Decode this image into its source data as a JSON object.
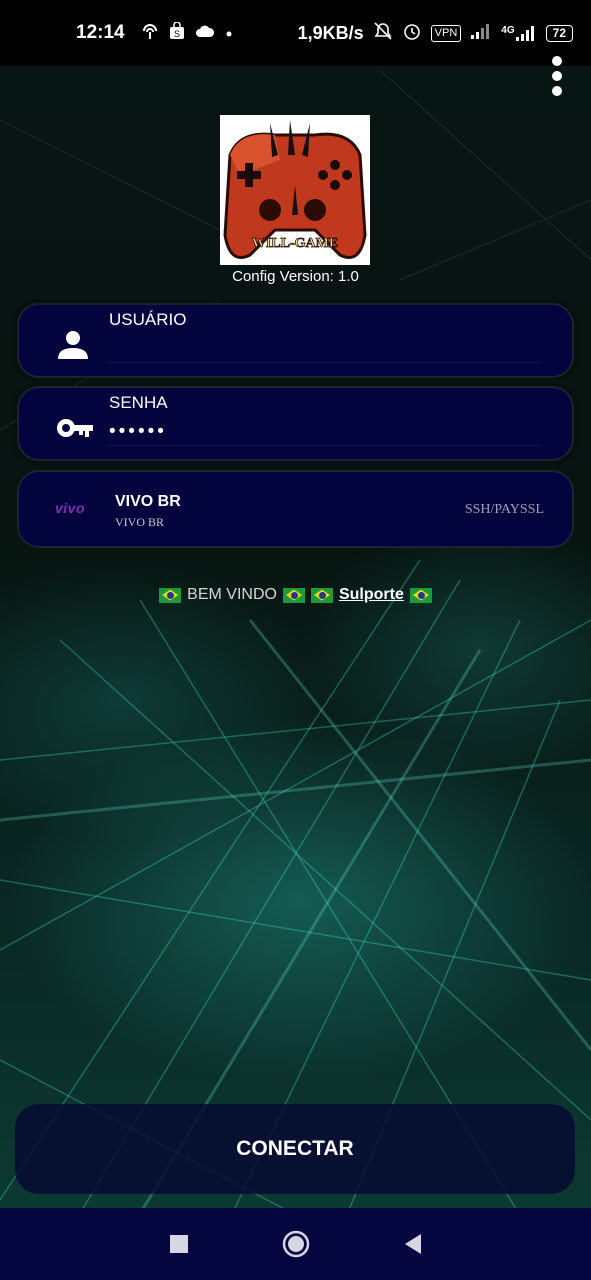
{
  "status_bar": {
    "time": "12:14",
    "net_speed": "1,9KB/s",
    "vpn": "VPN",
    "network_type": "4G",
    "battery": "72",
    "left_icons": [
      "hotspot-icon",
      "shopping-bag-icon",
      "cloud-icon",
      "dot-icon"
    ],
    "right_icons": [
      "mute-icon",
      "alarm-icon",
      "vpn-icon",
      "signal-icon",
      "signal-4g-icon",
      "battery-icon"
    ]
  },
  "header": {
    "menu_icon": "more-vert-icon",
    "logo_text": "WILL-GAME",
    "config_version": "Config Version: 1.0"
  },
  "login": {
    "user_label": "USUÁRIO",
    "user_value": "",
    "user_icon": "person-icon",
    "password_label": "SENHA",
    "password_value": "••••••",
    "password_icon": "key-icon"
  },
  "server": {
    "logo": "vivo",
    "name": "VIVO BR",
    "subtitle": "VIVO BR",
    "type": "SSH/PAYSSL"
  },
  "welcome": {
    "text": "BEM VINDO",
    "link": "Sulporte"
  },
  "connect_label": "CONECTAR",
  "navbar": {
    "recent_icon": "square-icon",
    "home_icon": "circle-icon",
    "back_icon": "triangle-back-icon"
  },
  "colors": {
    "card_bg": "#03033d",
    "navbar_bg": "#05053f",
    "vivo_purple": "#7f2fb0",
    "logo_red": "#c0391e"
  }
}
